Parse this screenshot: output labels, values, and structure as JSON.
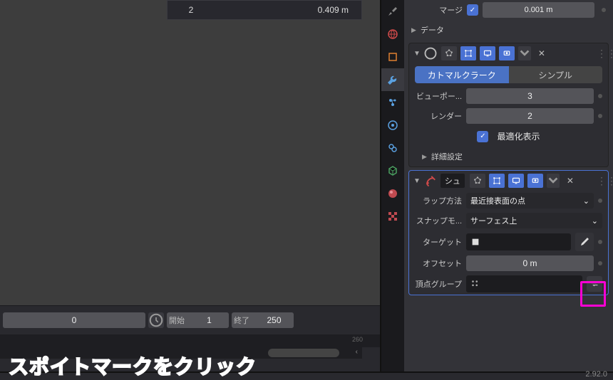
{
  "overlay_table": {
    "col_a": "2",
    "col_b": "0.409 m"
  },
  "timeline": {
    "current_frame": "0",
    "start_label": "開始",
    "start_value": "1",
    "end_label": "終了",
    "end_value": "250",
    "ticks": [
      "260"
    ]
  },
  "props": {
    "merge": {
      "label": "マージ",
      "value": "0.001 m"
    },
    "data_section": "データ",
    "subdiv": {
      "catmull": "カトマルクラーク",
      "simple": "シンプル",
      "viewport_label": "ビューポー...",
      "viewport_value": "3",
      "render_label": "レンダー",
      "render_value": "2",
      "optimal_label": "最適化表示",
      "advanced_label": "詳細設定"
    },
    "shrink": {
      "name": "シュ",
      "wrap_label": "ラップ方法",
      "wrap_value": "最近接表面の点",
      "snap_label": "スナップモ...",
      "snap_value": "サーフェス上",
      "target_label": "ターゲット",
      "offset_label": "オフセット",
      "offset_value": "0 m",
      "vgroup_label": "頂点グループ"
    }
  },
  "annotation": "スポイトマークをクリック",
  "version": "2.92.0"
}
